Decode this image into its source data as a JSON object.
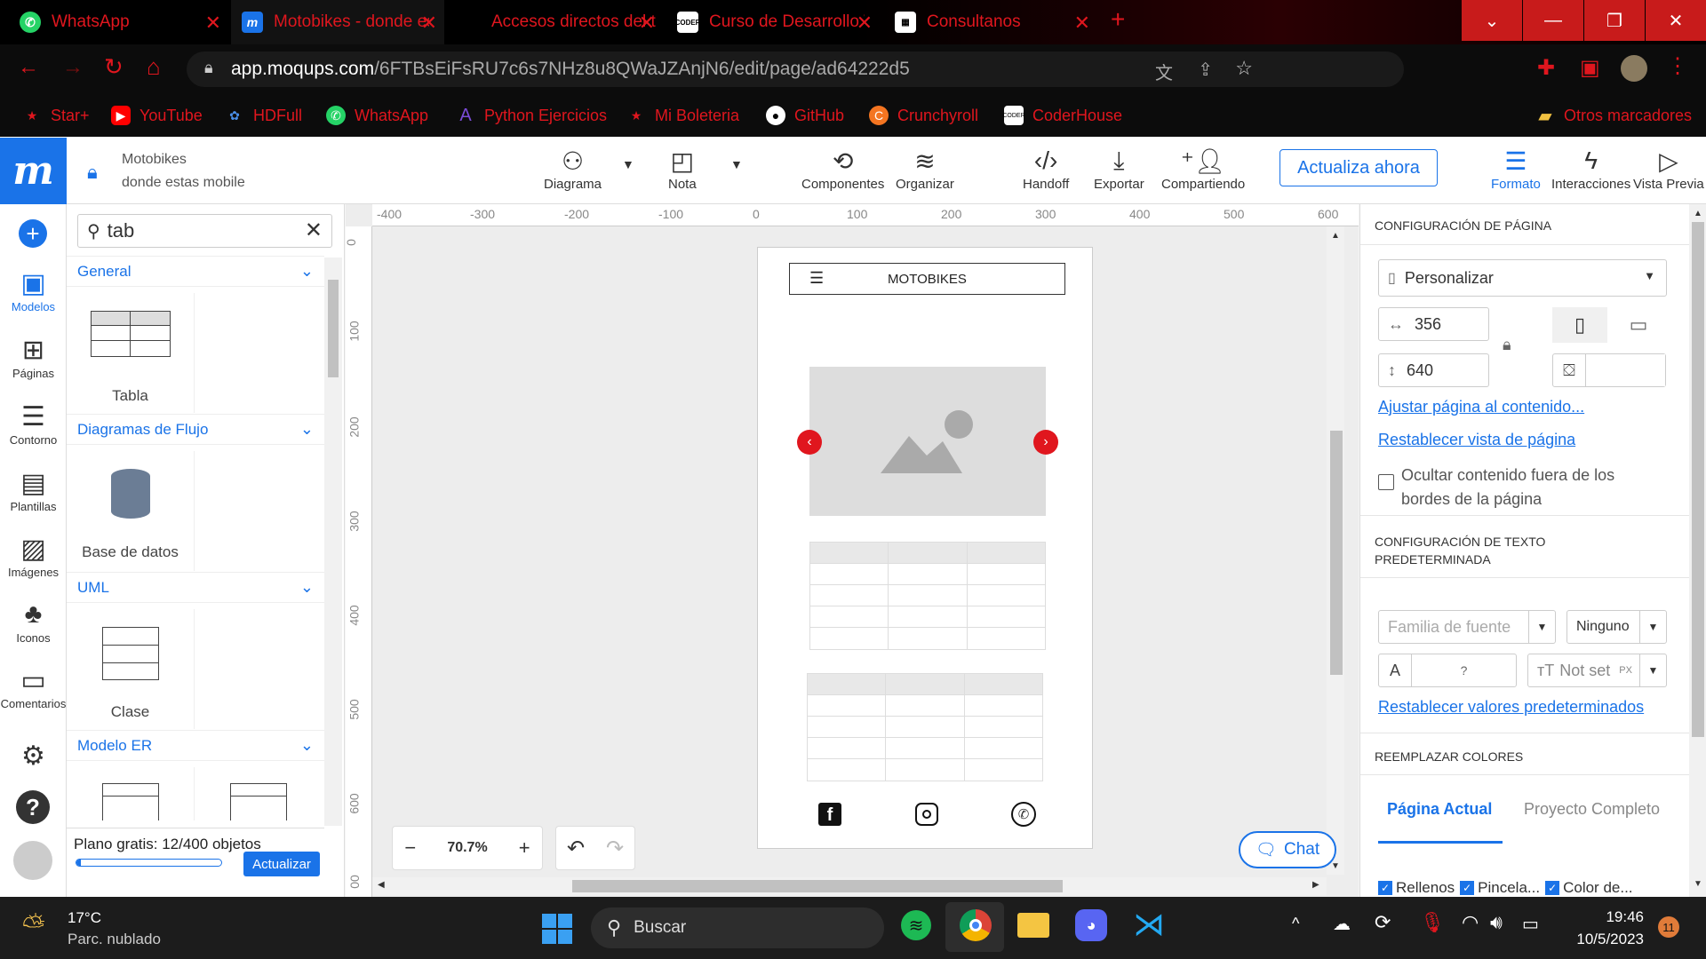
{
  "browser": {
    "tabs": [
      {
        "title": "WhatsApp",
        "icon": "whatsapp-icon"
      },
      {
        "title": "Motobikes - donde estas",
        "icon": "moqups-icon"
      },
      {
        "title": "Accesos directos del tecl",
        "icon": "windows-icon"
      },
      {
        "title": "Curso de Desarrollo Web",
        "icon": "coder-icon"
      },
      {
        "title": "Consultanos",
        "icon": "page-icon"
      }
    ],
    "url_domain": "app.moqups.com",
    "url_path": "/6FTBsEiFsRU7c6s7NHz8u8QWaJZAnjN6/edit/page/ad64222d5",
    "bookmarks": [
      "Star+",
      "YouTube",
      "HDFull",
      "WhatsApp",
      "Python Ejercicios",
      "Mi Boleteria",
      "GitHub",
      "Crunchyroll",
      "CoderHouse"
    ],
    "other_bookmarks": "Otros marcadores"
  },
  "project": {
    "name": "Motobikes",
    "page": "donde estas mobile"
  },
  "toolbar": {
    "items": [
      "Diagrama",
      "Nota",
      "Componentes",
      "Organizar",
      "Handoff",
      "Exportar",
      "Compartiendo"
    ],
    "update_button": "Actualiza ahora",
    "right_items": [
      "Formato",
      "Interacciones",
      "Vista Previa"
    ]
  },
  "rail": [
    "Modelos",
    "Páginas",
    "Contorno",
    "Plantillas",
    "Imágenes",
    "Iconos",
    "Comentarios"
  ],
  "panel": {
    "search_value": "tab",
    "sections": [
      "General",
      "Diagramas de Flujo",
      "UML",
      "Modelo ER"
    ],
    "tiles": [
      "Tabla",
      "Base de datos",
      "Clase"
    ],
    "plan_text": "Plano gratis: 12/400 objetos",
    "plan_fraction": 0.03,
    "upgrade_button": "Actualizar"
  },
  "canvas": {
    "ruler_h": [
      "-400",
      "-300",
      "-200",
      "-100",
      "0",
      "100",
      "200",
      "300",
      "400",
      "500",
      "600"
    ],
    "ruler_v": [
      "0",
      "100",
      "200",
      "300",
      "400",
      "500",
      "600",
      "00"
    ],
    "header_text": "MOTOBIKES",
    "zoom": "70.7%",
    "chat_label": "Chat"
  },
  "format": {
    "page_config_title": "CONFIGURACIÓN DE PÁGINA",
    "preset": "Personalizar",
    "width": "356",
    "height": "640",
    "fit_link": "Ajustar página al contenido...",
    "reset_link": "Restablecer vista de página",
    "hide_outside": "Ocultar contenido fuera de los bordes de la página",
    "text_config_title": "CONFIGURACIÓN DE TEXTO PREDETERMINADA",
    "font_family_placeholder": "Familia de fuente",
    "font_weight": "Ninguno",
    "font_color": "?",
    "font_size": "Not set",
    "font_unit": "PX",
    "reset_defaults": "Restablecer valores predeterminados",
    "replace_colors_title": "REEMPLAZAR COLORES",
    "scope_tabs": [
      "Página Actual",
      "Proyecto Completo"
    ],
    "checks": [
      "Rellenos",
      "Pincela...",
      "Color de..."
    ]
  },
  "taskbar": {
    "weather_temp": "17°C",
    "weather_desc": "Parc. nublado",
    "search": "Buscar",
    "time": "19:46",
    "date": "10/5/2023",
    "notifications": "11"
  }
}
